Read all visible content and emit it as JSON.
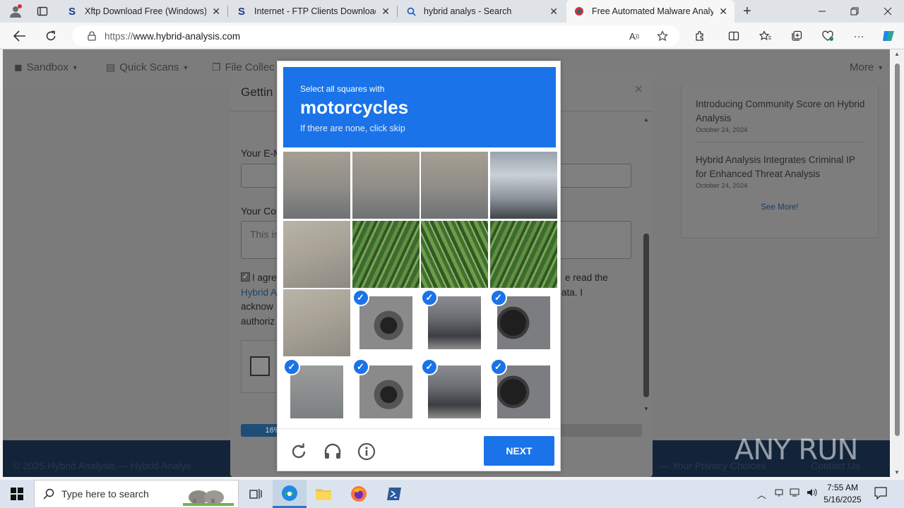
{
  "browser": {
    "tabs": [
      {
        "title": "Xftp Download Free (Windows) -",
        "icon": "softpedia-s-icon"
      },
      {
        "title": "Internet - FTP Clients Downloads",
        "icon": "softpedia-s-icon"
      },
      {
        "title": "hybrid analys - Search",
        "icon": "search-icon"
      },
      {
        "title": "Free Automated Malware Analysi",
        "icon": "hybrid-analysis-icon"
      }
    ],
    "url_scheme": "https://",
    "url_host": "www.hybrid-analysis.com"
  },
  "site": {
    "nav": {
      "sandbox": "Sandbox",
      "quick_scans": "Quick Scans",
      "file_collections": "File Collec",
      "more": "More"
    },
    "news": [
      {
        "title": "Introducing Community Score on Hybrid Analysis",
        "date": "October 24, 2024"
      },
      {
        "title": "Hybrid Analysis Integrates Criminal IP for Enhanced Threat Analysis",
        "date": "October 24, 2024"
      }
    ],
    "see_more": "See More!",
    "footer_copyright": "© 2025 Hybrid Analysis — Hybrid Analys",
    "footer_privacy": "— Your Privacy Choices",
    "footer_contact": "Contact Us"
  },
  "modal": {
    "title": "Gettin",
    "email_label": "Your E-M",
    "comment_label": "Your Co",
    "comment_placeholder": "This is",
    "agree_line1": "I agre",
    "agree_line1_tail": "e read the",
    "agree_link": "Hybrid A",
    "agree_line2_tail": "ata. I",
    "agree_line3": "acknow",
    "agree_line4": "authoriz",
    "progress_label": "16%",
    "progress": 0.16
  },
  "captcha": {
    "instruction": "Select all squares with",
    "target": "motorcycles",
    "hint": "If there are none, click skip",
    "cells": [
      {
        "texture": "t-street",
        "selected": false
      },
      {
        "texture": "t-street",
        "selected": false
      },
      {
        "texture": "t-street",
        "selected": false
      },
      {
        "texture": "t-car",
        "selected": false
      },
      {
        "texture": "t-pave",
        "selected": false
      },
      {
        "texture": "t-leaf",
        "selected": false
      },
      {
        "texture": "t-leaf2",
        "selected": false
      },
      {
        "texture": "t-leaf",
        "selected": false
      },
      {
        "texture": "t-pave",
        "selected": false
      },
      {
        "texture": "t-moto",
        "selected": true
      },
      {
        "texture": "t-rider",
        "selected": true
      },
      {
        "texture": "t-wheel",
        "selected": true
      },
      {
        "texture": "t-road",
        "selected": true
      },
      {
        "texture": "t-moto",
        "selected": true
      },
      {
        "texture": "t-rider",
        "selected": true
      },
      {
        "texture": "t-wheel",
        "selected": true
      }
    ],
    "next_label": "NEXT"
  },
  "watermark": "ANY RUN",
  "taskbar": {
    "search_placeholder": "Type here to search",
    "time": "7:55 AM",
    "date": "5/16/2025"
  }
}
